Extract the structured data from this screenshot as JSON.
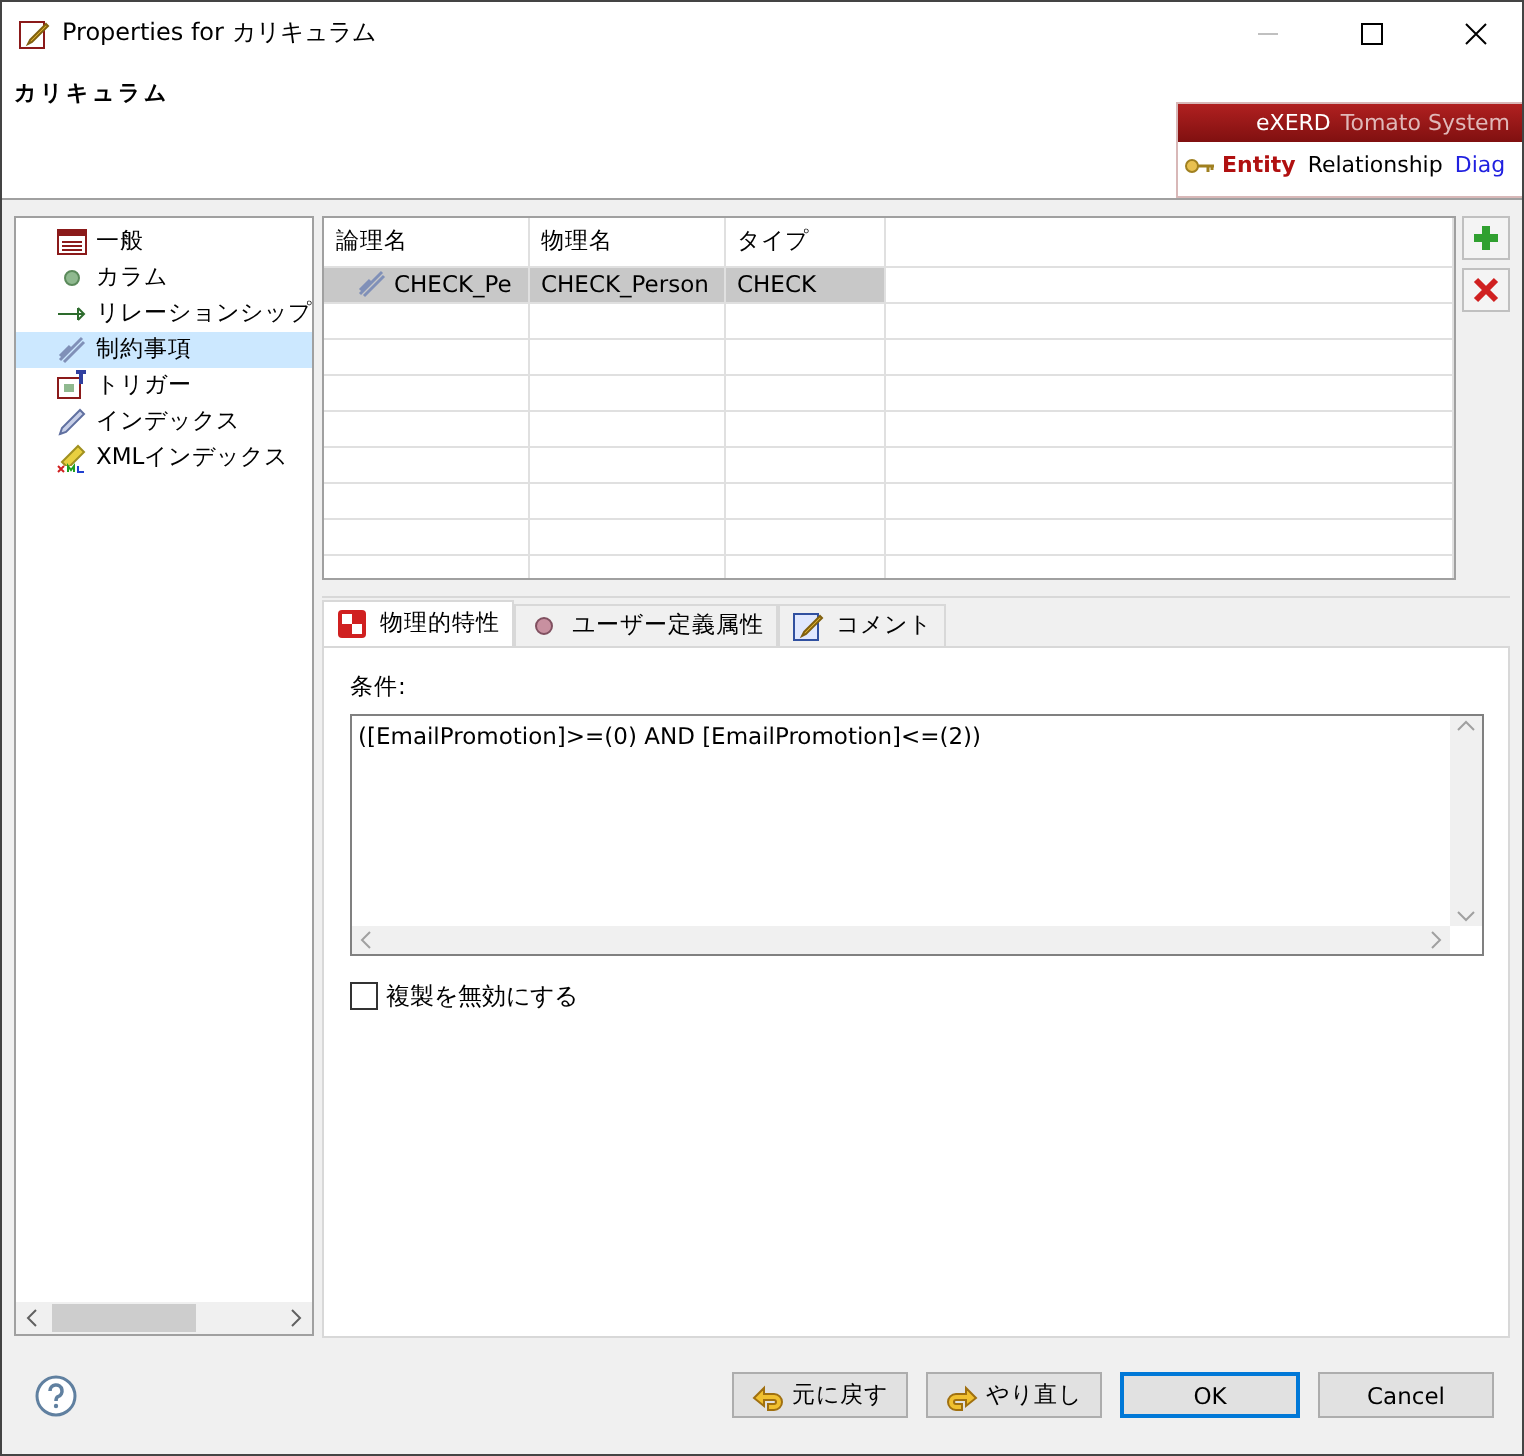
{
  "window": {
    "title": "Properties for カリキュラム"
  },
  "header": {
    "title": "カリキュラム",
    "banner": {
      "brand": "eXERD",
      "product": "Tomato System",
      "tabs": [
        {
          "label": "Entity",
          "selected": true,
          "kind": "key"
        },
        {
          "label": "Relationship",
          "selected": false,
          "kind": "plain"
        },
        {
          "label": "Diag",
          "selected": false,
          "kind": "link"
        }
      ]
    }
  },
  "sidebar": {
    "items": [
      {
        "label": "一般",
        "kind": "table",
        "selected": false
      },
      {
        "label": "カラム",
        "kind": "column",
        "selected": false
      },
      {
        "label": "リレーションシップ",
        "kind": "relationship",
        "selected": false
      },
      {
        "label": "制約事項",
        "kind": "constraint",
        "selected": true
      },
      {
        "label": "トリガー",
        "kind": "trigger",
        "selected": false
      },
      {
        "label": "インデックス",
        "kind": "index",
        "selected": false
      },
      {
        "label": "XMLインデックス",
        "kind": "xml-index",
        "selected": false
      }
    ]
  },
  "table": {
    "columns": [
      "論理名",
      "物理名",
      "タイプ"
    ],
    "rows": [
      {
        "cells": [
          "CHECK_Pe",
          "CHECK_Person",
          "CHECK"
        ],
        "selected": true
      }
    ]
  },
  "tabs": [
    {
      "label": "物理的特性",
      "kind": "physical",
      "selected": true
    },
    {
      "label": "ユーザー定義属性",
      "kind": "user",
      "selected": false
    },
    {
      "label": "コメント",
      "kind": "comment",
      "selected": false
    }
  ],
  "condition": {
    "label": "条件:",
    "value": "([EmailPromotion]>=(0) AND [EmailPromotion]<=(2))"
  },
  "disable_replication": {
    "label": "複製を無効にする",
    "checked": false
  },
  "buttons": [
    {
      "label": "元に戻す",
      "kind": "undo",
      "default": false
    },
    {
      "label": "やり直し",
      "kind": "redo",
      "default": false
    },
    {
      "label": "OK",
      "kind": "plain",
      "default": true
    },
    {
      "label": "Cancel",
      "kind": "plain",
      "default": false
    }
  ]
}
